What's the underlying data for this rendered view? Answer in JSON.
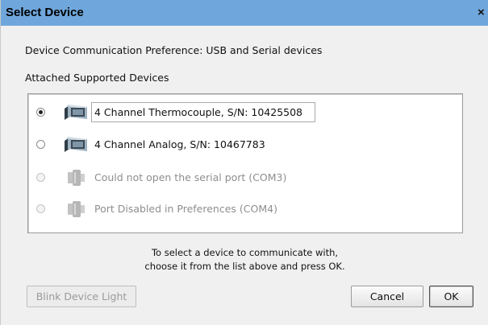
{
  "window": {
    "title": "Select Device",
    "close_glyph": "×"
  },
  "preference_label": "Device Communication Preference:  USB and Serial devices",
  "attached_label": "Attached Supported Devices",
  "devices": [
    {
      "label": "4 Channel Thermocouple, S/N: 10425508",
      "selected": true,
      "enabled": true,
      "icon": "usb-device-icon"
    },
    {
      "label": "4 Channel Analog, S/N: 10467783",
      "selected": false,
      "enabled": true,
      "icon": "usb-device-icon"
    },
    {
      "label": "Could not open the serial port (COM3)",
      "selected": false,
      "enabled": false,
      "icon": "serial-port-icon"
    },
    {
      "label": "Port Disabled in Preferences (COM4)",
      "selected": false,
      "enabled": false,
      "icon": "serial-port-icon"
    }
  ],
  "hint": {
    "line1": "To select a device to communicate with,",
    "line2": "choose it from the list above and press OK."
  },
  "buttons": {
    "blink": "Blink Device Light",
    "cancel": "Cancel",
    "ok": "OK"
  }
}
